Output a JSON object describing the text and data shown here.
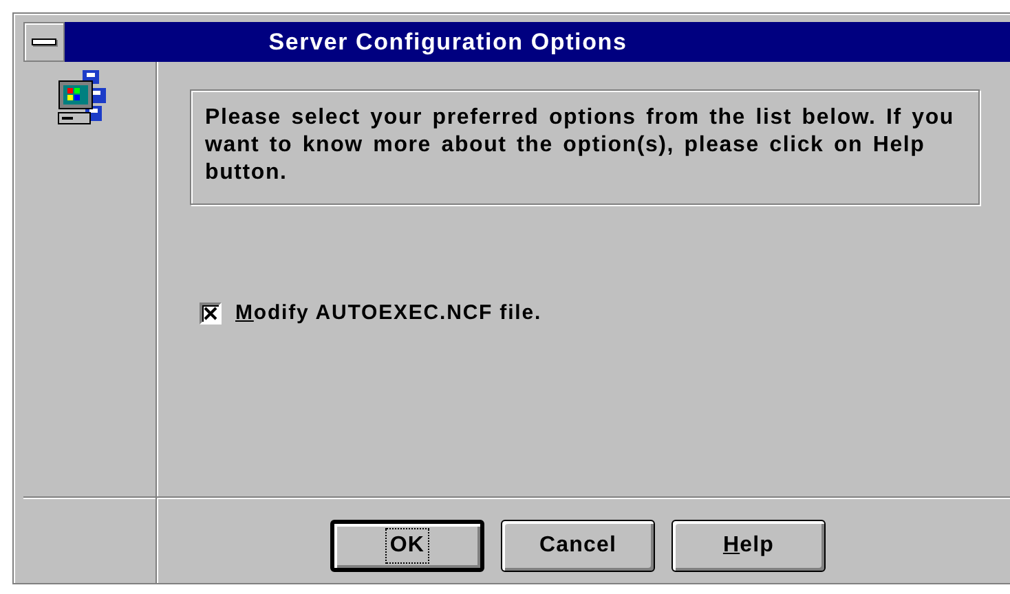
{
  "window": {
    "title": "Server Configuration Options"
  },
  "message": "Please select your preferred options from the list below.  If you want to know more about the option(s), please click on Help button.",
  "options": [
    {
      "label": "Modify AUTOEXEC.NCF file.",
      "checked": true,
      "mnemonic_underlined": true
    }
  ],
  "buttons": [
    {
      "label": "OK",
      "default": true,
      "focused": true,
      "mnemonic_underlined": false
    },
    {
      "label": "Cancel",
      "default": false,
      "focused": false,
      "mnemonic_underlined": false
    },
    {
      "label": "Help",
      "default": false,
      "focused": false,
      "mnemonic_underlined": true
    }
  ]
}
